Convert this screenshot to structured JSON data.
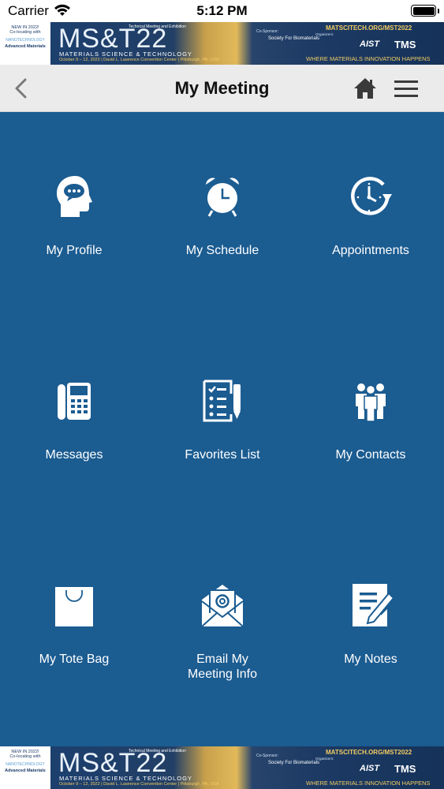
{
  "status_bar": {
    "carrier": "Carrier",
    "time": "5:12 PM"
  },
  "banner": {
    "new_text": "NEW IN 2022!",
    "colocating": "Co-locating with",
    "nano": "NANOTECHNOLOGY",
    "advanced": "Advanced Materials",
    "logo": "MS&T22",
    "tagline_top": "Technical Meeting and Exhibition",
    "subtitle": "MATERIALS SCIENCE & TECHNOLOGY",
    "dates": "October 9 – 12, 2022 | David L. Lawrence Convention Center | Pittsburgh, PA, USA",
    "cosponsor": "Co-Sponsor:",
    "sfb": "Society For Biomaterials",
    "url": "MATSCITECH.ORG/MST2022",
    "organizers": "Organizers:",
    "aist": "AIST",
    "tms": "TMS",
    "slogan": "WHERE MATERIALS INNOVATION HAPPENS"
  },
  "nav": {
    "title": "My Meeting"
  },
  "tiles": [
    {
      "label": "My Profile",
      "icon": "profile-head-icon"
    },
    {
      "label": "My Schedule",
      "icon": "alarm-clock-icon"
    },
    {
      "label": "Appointments",
      "icon": "clock-arrow-icon"
    },
    {
      "label": "Messages",
      "icon": "fax-phone-icon"
    },
    {
      "label": "Favorites List",
      "icon": "checklist-icon"
    },
    {
      "label": "My Contacts",
      "icon": "people-icon"
    },
    {
      "label": "My Tote Bag",
      "icon": "bag-icon"
    },
    {
      "label": "Email My\nMeeting Info",
      "icon": "email-icon"
    },
    {
      "label": "My Notes",
      "icon": "notes-icon"
    }
  ],
  "colors": {
    "background": "#1b5c91",
    "nav_bg": "#ebebeb",
    "accent_gold": "#f2cc62"
  }
}
